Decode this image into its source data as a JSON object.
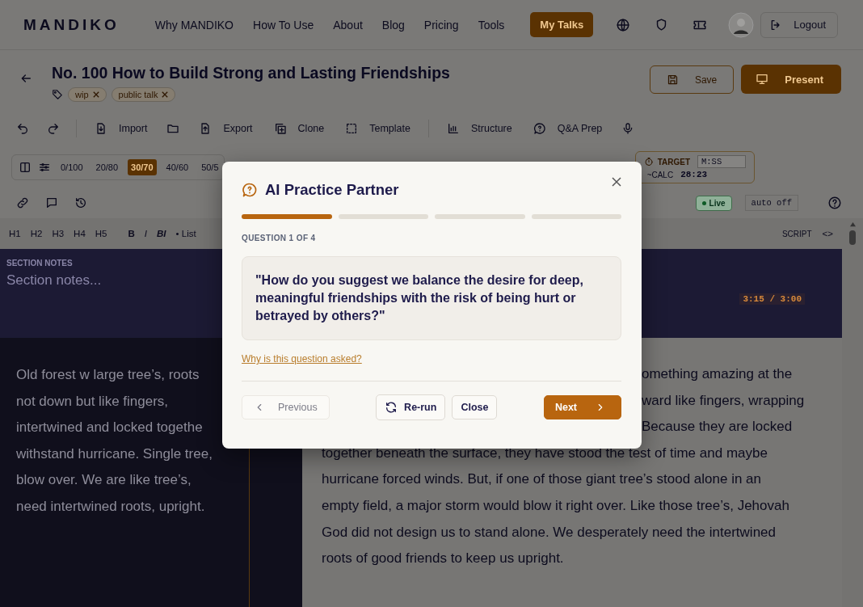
{
  "nav": {
    "logo": "MANDIKO",
    "links": [
      {
        "label": "Why MANDIKO",
        "selected": false
      },
      {
        "label": "How To Use",
        "selected": false
      },
      {
        "label": "About",
        "selected": false
      },
      {
        "label": "Blog",
        "selected": false
      },
      {
        "label": "Pricing",
        "selected": false
      },
      {
        "label": "Tools",
        "selected": false
      },
      {
        "label": "My Talks",
        "selected": true
      }
    ],
    "logout": "Logout"
  },
  "talk": {
    "title": "No. 100 How to Build Strong and Lasting Friendships",
    "tags": [
      {
        "label": "wip"
      },
      {
        "label": "public talk"
      }
    ],
    "save": "Save",
    "present": "Present"
  },
  "toolbar": {
    "import": "Import",
    "export": "Export",
    "clone": "Clone",
    "template": "Template",
    "structure": "Structure",
    "qa": "Q&A Prep"
  },
  "ratios": [
    {
      "label": "0/100",
      "selected": false
    },
    {
      "label": "20/80",
      "selected": false
    },
    {
      "label": "30/70",
      "selected": true
    },
    {
      "label": "40/60",
      "selected": false
    },
    {
      "label": "50/5",
      "selected": false
    }
  ],
  "timer": {
    "target_label": "TARGET",
    "target_placeholder": "M:SS",
    "calc_label": "~CALC",
    "calc_value": "28:23"
  },
  "status": {
    "live": "Live",
    "autosave": "auto off"
  },
  "format": {
    "buttons": [
      {
        "label": "H1",
        "kind": "plain"
      },
      {
        "label": "H2",
        "kind": "plain"
      },
      {
        "label": "H3",
        "kind": "plain"
      },
      {
        "label": "H4",
        "kind": "plain"
      },
      {
        "label": "H5",
        "kind": "plain"
      },
      {
        "label": "B",
        "kind": "bold"
      },
      {
        "label": "I",
        "kind": "italic"
      },
      {
        "label": "BI",
        "kind": "bolditalic"
      },
      {
        "label": "• List",
        "kind": "plain"
      }
    ],
    "mode": "SCRIPT",
    "code": "<>"
  },
  "notes": {
    "label": "SECTION NOTES",
    "placeholder": "Section notes...",
    "timing": "3:15 / 3:00"
  },
  "outline": [
    "Old forest w large tree’s, roots",
    "not down but like fingers,",
    "intertwined and locked togethe",
    "withstand hurricane. Single tree,",
    "blow over. We are like tree’s,",
    "need intertwined roots, upright."
  ],
  "script": [
    {
      "text": "omething amazing at the",
      "kind": "partial"
    },
    {
      "text": "ward like fingers, wrapping",
      "kind": "partial"
    },
    {
      "text": "Because they are locked",
      "kind": "partial"
    },
    {
      "text": "together beneath the surface, they have stood the test of time and maybe",
      "kind": "full"
    },
    {
      "text": "hurricane forced winds. But, if one of those giant tree’s stood alone in an",
      "kind": "full"
    },
    {
      "text": "empty field, a major storm would blow it right over. Like those tree’s, Jehovah",
      "kind": "full"
    },
    {
      "text": "God did not design us to stand alone. We desperately need the intertwined",
      "kind": "full"
    },
    {
      "text": "roots of good friends to keep us upright.",
      "kind": "full"
    }
  ],
  "modal": {
    "title": "AI Practice Partner",
    "steps": [
      {
        "active": true
      },
      {
        "active": false
      },
      {
        "active": false
      },
      {
        "active": false
      }
    ],
    "counter": "QUESTION 1 OF 4",
    "question": "\"How do you suggest we balance the desire for deep, meaningful friendships with the risk of being hurt or betrayed by others?\"",
    "why_link": "Why is this question asked?",
    "previous": {
      "label": "Previous",
      "disabled": true
    },
    "rerun": "Re-run",
    "close": "Close",
    "next": "Next"
  }
}
